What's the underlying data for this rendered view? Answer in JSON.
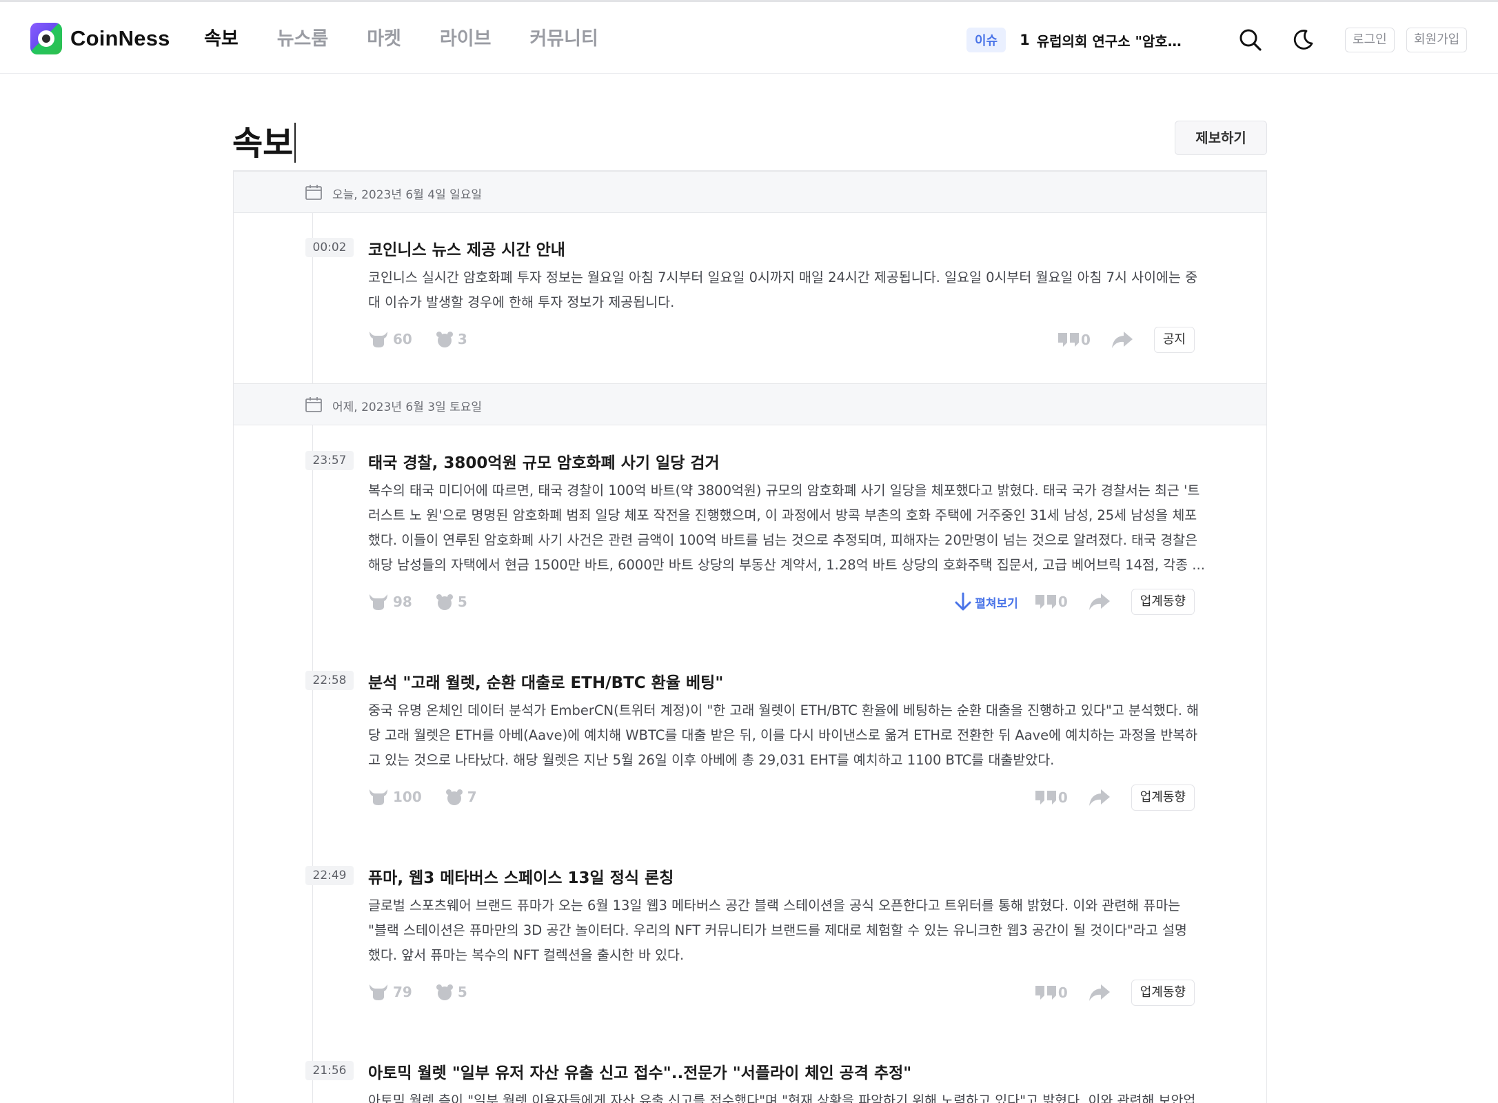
{
  "header": {
    "brand": "CoinNess",
    "nav": [
      {
        "label": "속보",
        "active": true
      },
      {
        "label": "뉴스룸",
        "active": false
      },
      {
        "label": "마켓",
        "active": false
      },
      {
        "label": "라이브",
        "active": false
      },
      {
        "label": "커뮤니티",
        "active": false
      }
    ],
    "issue_badge": "이슈",
    "issue_rank": "1",
    "issue_text": "유럽의회 연구소 \"암호화...",
    "icons": {
      "search": "search-icon",
      "theme": "moon-icon"
    },
    "login": "로그인",
    "signup": "회원가입"
  },
  "page": {
    "title": "속보",
    "report_button": "제보하기"
  },
  "dates": [
    {
      "label": "오늘, 2023년 6월 4일 일요일"
    },
    {
      "label": "어제, 2023년 6월 3일 토요일"
    }
  ],
  "items": [
    {
      "time": "00:02",
      "title": "코인니스 뉴스 제공 시간 안내",
      "body": [
        "코인니스 실시간 암호화폐 투자 정보는 월요일 아침 7시부터 일요일 0시까지 매일 24시간 제공됩니다. 일요일 0시부터 월요일 아침 7시 사이에는 중",
        "대 이슈가 발생할 경우에 한해 투자 정보가 제공됩니다."
      ],
      "bull": "60",
      "bear": "3",
      "comments": "0",
      "tag": "공지"
    },
    {
      "time": "23:57",
      "title": "태국 경찰, 3800억원 규모 암호화폐 사기 일당 검거",
      "body": [
        "복수의 태국 미디어에 따르면, 태국 경찰이 100억 바트(약 3800억원) 규모의 암호화폐 사기 일당을 체포했다고 밝혔다. 태국 국가 경찰서는 최근 '트",
        "러스트 노 원'으로 명명된 암호화폐 범죄 일당 체포 작전을 진행했으며, 이 과정에서 방콕 부촌의 호화 주택에 거주중인 31세 남성, 25세 남성을 체포",
        "했다. 이들이 연루된 암호화폐 사기 사건은 관련 금액이 100억 바트를 넘는 것으로 추정되며, 피해자는 20만명이 넘는 것으로 알려졌다. 태국 경찰은",
        "해당 남성들의 자택에서 현금 1500만 바트, 6000만 바트 상당의 부동산 계약서, 1.28억 바트 상당의 호화주택 집문서, 고급 베어브릭 14점, 각종 ..."
      ],
      "bull": "98",
      "bear": "5",
      "expand": "펼쳐보기",
      "comments": "0",
      "tag": "업계동향"
    },
    {
      "time": "22:58",
      "title": "분석 \"고래 월렛, 순환 대출로 ETH/BTC 환율 베팅\"",
      "body": [
        "중국 유명 온체인 데이터 분석가 EmberCN(트위터 계정)이 \"한 고래 월렛이 ETH/BTC 환율에 베팅하는 순환 대출을 진행하고 있다\"고 분석했다. 해",
        "당 고래 월렛은 ETH를 아베(Aave)에 예치해 WBTC를 대출 받은 뒤, 이를 다시 바이낸스로 옮겨 ETH로 전환한 뒤 Aave에 예치하는 과정을 반복하",
        "고 있는 것으로 나타났다. 해당 월렛은 지난 5월 26일 이후 아베에 총 29,031 EHT를 예치하고 1100 BTC를 대출받았다."
      ],
      "bull": "100",
      "bear": "7",
      "comments": "0",
      "tag": "업계동향"
    },
    {
      "time": "22:49",
      "title": "퓨마, 웹3 메타버스 스페이스 13일 정식 론칭",
      "body": [
        "글로벌 스포츠웨어 브랜드 퓨마가 오는 6월 13일 웹3 메타버스 공간 블랙 스테이션을 공식 오픈한다고 트위터를 통해 밝혔다. 이와 관련해 퓨마는",
        "\"블랙 스테이션은 퓨마만의 3D 공간 놀이터다. 우리의 NFT 커뮤니티가 브랜드를 제대로 체험할 수 있는 유니크한 웹3 공간이 될 것이다\"라고 설명",
        "했다. 앞서 퓨마는 복수의 NFT 컬렉션을 출시한 바 있다."
      ],
      "bull": "79",
      "bear": "5",
      "comments": "0",
      "tag": "업계동향"
    },
    {
      "time": "21:56",
      "title": "아토믹 월렛 \"일부 유저 자산 유출 신고 접수\"..전문가 \"서플라이 체인 공격 추정\"",
      "body": [
        "아토믹 월렛 측이 \"일부 월렛 이용자들에게 자산 유출 신고를 접수했다\"며 \"현재 상황을 파악하기 위해 노력하고 있다\"고 밝혔다. 이와 관련해 보안업"
      ]
    }
  ],
  "colors": {
    "accent": "#4a74e8",
    "muted": "#c2c4c9",
    "date_bg": "#f6f7f9"
  }
}
